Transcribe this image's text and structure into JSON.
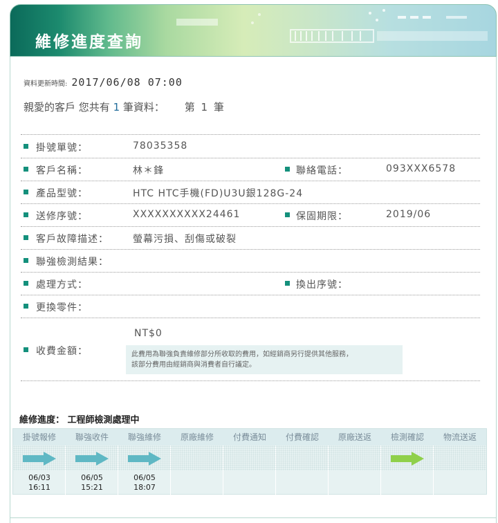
{
  "header": {
    "title": "維修進度查詢"
  },
  "update": {
    "label": "資料更新時間:",
    "value": "2017/06/08 07:00"
  },
  "greeting": {
    "prefix": "親愛的客戶 您共有",
    "count": "1",
    "suffix": "筆資料：",
    "index_prefix": "第",
    "index": "1",
    "index_suffix": "筆"
  },
  "fields": {
    "ticket_no": {
      "label": "掛號單號：",
      "value": "78035358"
    },
    "customer_name": {
      "label": "客戶名稱：",
      "value": "林＊鋒"
    },
    "phone": {
      "label": "聯絡電話：",
      "value": "093XXX6578"
    },
    "model": {
      "label": "產品型號：",
      "value": "HTC HTC手機(FD)U3U銀128G-24"
    },
    "serial": {
      "label": "送修序號：",
      "value": "XXXXXXXXXX24461"
    },
    "warranty": {
      "label": "保固期限：",
      "value": "2019/06"
    },
    "fault": {
      "label": "客戶故障描述：",
      "value": "螢幕污損、刮傷或破裂"
    },
    "result": {
      "label": "聯強檢測結果：",
      "value": ""
    },
    "handling": {
      "label": "處理方式：",
      "value": ""
    },
    "exchange_serial": {
      "label": "換出序號：",
      "value": ""
    },
    "parts": {
      "label": "更換零件：",
      "value": ""
    },
    "fee": {
      "label": "收費金額：",
      "value": "NT$0",
      "note_line1": "此費用為聯強負責維修部分所收取的費用，如經銷商另行提供其他服務，",
      "note_line2": "該部分費用由經銷商與消費者自行議定。"
    }
  },
  "progress": {
    "label": "維修進度：",
    "status": "工程師檢測處理中",
    "steps": [
      {
        "label": "掛號報修",
        "date": "06/03",
        "time": "16:11",
        "arrow": "done"
      },
      {
        "label": "聯強收件",
        "date": "06/05",
        "time": "15:21",
        "arrow": "done"
      },
      {
        "label": "聯強維修",
        "date": "06/05",
        "time": "18:07",
        "arrow": "done"
      },
      {
        "label": "原廠維修",
        "date": "",
        "time": "",
        "arrow": "none"
      },
      {
        "label": "付費通知",
        "date": "",
        "time": "",
        "arrow": "none"
      },
      {
        "label": "付費確認",
        "date": "",
        "time": "",
        "arrow": "none"
      },
      {
        "label": "原廠送返",
        "date": "",
        "time": "",
        "arrow": "none"
      },
      {
        "label": "檢測確認",
        "date": "",
        "time": "",
        "arrow": "current"
      },
      {
        "label": "物流送返",
        "date": "",
        "time": "",
        "arrow": "none"
      }
    ]
  },
  "colors": {
    "accent": "#14907c",
    "arrow_done": "#5fb8c4",
    "arrow_current": "#8fd04a"
  }
}
